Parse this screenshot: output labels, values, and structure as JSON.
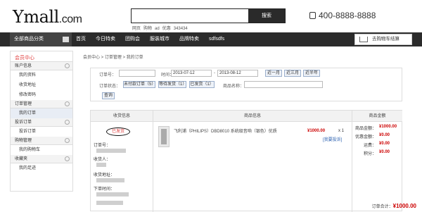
{
  "header": {
    "logo_main": "Ymall",
    "logo_domain": ".com",
    "search_button": "搜索",
    "hot_words": [
      "网页",
      "购物",
      "ad",
      "优惠",
      "343434"
    ],
    "phone": "400-8888-8888"
  },
  "nav": {
    "category": "全部商品分类",
    "items": [
      "首页",
      "今日特卖",
      "团购会",
      "服装城市",
      "品牌特卖",
      "sdfsdfs"
    ],
    "cart": "去购物车结算"
  },
  "sidebar": {
    "title": "会员中心",
    "groups": [
      {
        "label": "账户信息",
        "items": [
          "我的资料",
          "收货地址",
          "修改密码"
        ]
      },
      {
        "label": "订单管理",
        "items": [
          "我的订单"
        ]
      },
      {
        "label": "投诉订单",
        "items": [
          "投诉订单"
        ]
      },
      {
        "label": "购物管理",
        "items": [
          "我的购物车"
        ]
      },
      {
        "label": "收藏夹",
        "items": [
          "我的足迹"
        ]
      }
    ]
  },
  "breadcrumb": "会员中心 > 订单管理 > 我的订单",
  "filter": {
    "order_no_label": "订单号：",
    "time_label": "时间：",
    "date_from": "2013-07-12",
    "date_sep": "-",
    "date_to": "2013-08-12",
    "btn_month": "近一月",
    "btn_3month": "近三月",
    "btn_half": "近半年",
    "status_label": "订单状态：",
    "btn_unpaid": "未付款订单（5）",
    "btn_wait_ship": "等待发货（1）",
    "btn_shipped": "已发货（1）",
    "product_label": "商品名称：",
    "query": "查询"
  },
  "table": {
    "col_receive": "收货信息",
    "col_product": "商品信息",
    "col_amount": "商品金额",
    "status": "已发货",
    "label_order_no": "订单号：",
    "label_receiver": "收货人：",
    "label_address": "收货地址：",
    "label_time": "下单时间：",
    "product_name": "飞利浦（PHILIPS）DBD8010 系统级音响（银色）优质",
    "product_price": "¥1000.00",
    "product_qty": "x 1",
    "complaint_link": "[我要投诉]",
    "sum_goods_label": "商品金额：",
    "sum_goods": "¥1000.00",
    "sum_coupon_label": "优惠金额：",
    "sum_coupon": "¥0.00",
    "sum_freight_label": "运费：",
    "sum_freight": "¥0.00",
    "sum_points_label": "积分：",
    "sum_points": "¥0.00",
    "total_label": "订单合计：",
    "total_value": "¥1000.00"
  }
}
